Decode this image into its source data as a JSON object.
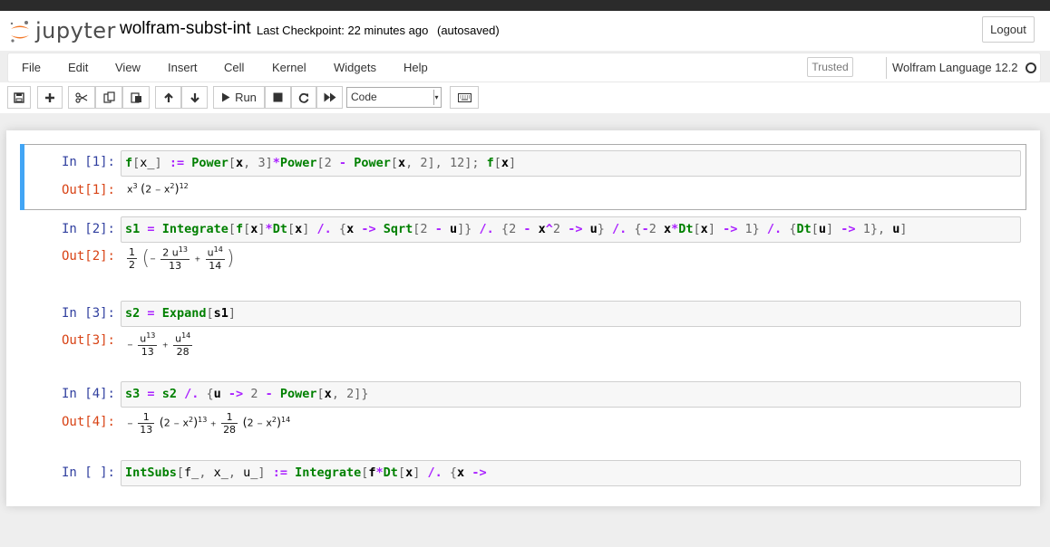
{
  "header": {
    "logo_text": "jupyter",
    "notebook_name": "wolfram-subst-int",
    "checkpoint": "Last Checkpoint: 22 minutes ago",
    "autosave_status": "(autosaved)",
    "logout_label": "Logout",
    "logo_colors": {
      "orange": "#f37726",
      "gray": "#767677"
    }
  },
  "menu": {
    "items": [
      "File",
      "Edit",
      "View",
      "Insert",
      "Cell",
      "Kernel",
      "Widgets",
      "Help"
    ],
    "trusted_label": "Trusted",
    "kernel_name": "Wolfram Language 12.2"
  },
  "toolbar": {
    "buttons": [
      {
        "name": "save",
        "icon": "floppy-disk-icon"
      },
      {
        "name": "insert-cell",
        "icon": "plus-icon"
      },
      {
        "name": "cut",
        "icon": "scissors-icon"
      },
      {
        "name": "copy",
        "icon": "copy-icon"
      },
      {
        "name": "paste",
        "icon": "paste-icon"
      },
      {
        "name": "move-up",
        "icon": "arrow-up-icon"
      },
      {
        "name": "move-down",
        "icon": "arrow-down-icon"
      },
      {
        "name": "run",
        "icon": "play-icon"
      },
      {
        "name": "interrupt",
        "icon": "stop-icon"
      },
      {
        "name": "restart",
        "icon": "refresh-icon"
      },
      {
        "name": "restart-run-all",
        "icon": "fast-forward-icon"
      },
      {
        "name": "command-palette",
        "icon": "keyboard-icon"
      }
    ],
    "run_label": "Run",
    "cell_type": "Code",
    "colors": {
      "selected_cell_bar": "#42a5f5",
      "in_prompt": "#303f9f",
      "out_prompt": "#d84315"
    }
  },
  "cells": [
    {
      "in_prompt": "In [1]:",
      "out_prompt": "Out[1]:",
      "code": "f[x_] := Power[x, 3]*Power[2 - Power[x, 2], 12]; f[x]",
      "output": "x³ (2 − x²)¹²"
    },
    {
      "in_prompt": "In [2]:",
      "out_prompt": "Out[2]:",
      "code": "s1 = Integrate[f[x]*Dt[x] /. {x -> Sqrt[2 - u]} /. {2 - x^2 -> u} /. {-2 x*Dt[x] -> 1} /. {Dt[u] -> 1}, u]",
      "output": "1/2 (−2 u¹³/13 + u¹⁴/14)"
    },
    {
      "in_prompt": "In [3]:",
      "out_prompt": "Out[3]:",
      "code": "s2 = Expand[s1]",
      "output": "−u¹³/13 + u¹⁴/28"
    },
    {
      "in_prompt": "In [4]:",
      "out_prompt": "Out[4]:",
      "code": "s3 = s2 /. {u -> 2 - Power[x, 2]}",
      "output": "−1/13 (2 − x²)¹³ + 1/28 (2 − x²)¹⁴"
    },
    {
      "in_prompt": "In [ ]:",
      "code": "IntSubs[f_, x_, u_] := Integrate[f*Dt[x] /. {x ->"
    }
  ]
}
